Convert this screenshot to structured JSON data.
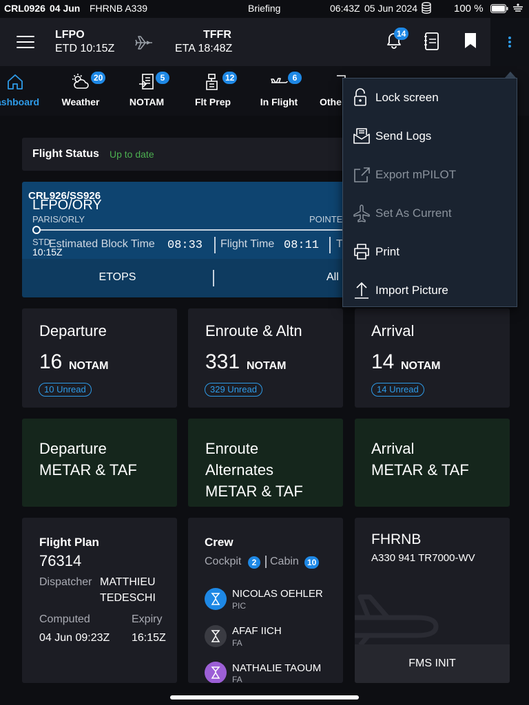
{
  "status_bar": {
    "flight_code": "CRL0926",
    "date_short": "04 Jun",
    "aircraft": "FHRNB A339",
    "app_title": "Briefing",
    "time": "06:43Z",
    "date_long": "05 Jun 2024",
    "battery": "100 %"
  },
  "header": {
    "origin": "LFPO",
    "etd": "ETD 10:15Z",
    "destination": "TFFR",
    "eta": "ETA 18:48Z",
    "notification_count": "14"
  },
  "tabs": [
    {
      "label": "ashboard",
      "icon": "home-icon",
      "badge": ""
    },
    {
      "label": "Weather",
      "icon": "weather-icon",
      "badge": "20"
    },
    {
      "label": "NOTAM",
      "icon": "notam-icon",
      "badge": "5"
    },
    {
      "label": "Flt Prep",
      "icon": "flt-prep-icon",
      "badge": "12"
    },
    {
      "label": "In Flight",
      "icon": "in-flight-icon",
      "badge": "6"
    },
    {
      "label": "Othe",
      "icon": "other-icon",
      "badge": ""
    }
  ],
  "flight_status": {
    "title": "Flight Status",
    "state": "Up to date"
  },
  "flight_banner": {
    "callsign": "CRL926/SS926",
    "airport_code": "LFPO/ORY",
    "airport_name": "PARIS/ORLY",
    "dest_name": "POINTE",
    "std_label": "STD",
    "std_time": "10:15Z",
    "ebt_label": "Estimated Block Time",
    "ebt_value": "08:33",
    "ft_label": "Flight Time",
    "ft_value": "08:11",
    "extra": "T",
    "etops": "ETOPS",
    "all": "All"
  },
  "notam_cards": [
    {
      "title": "Departure",
      "count": "16",
      "unit": "NOTAM",
      "unread": "10 Unread"
    },
    {
      "title": "Enroute & Altn",
      "count": "331",
      "unit": "NOTAM",
      "unread": "329 Unread"
    },
    {
      "title": "Arrival",
      "count": "14",
      "unit": "NOTAM",
      "unread": "14 Unread"
    }
  ],
  "metar_cards": [
    {
      "line1": "Departure",
      "line2": "METAR & TAF",
      "line3": ""
    },
    {
      "line1": "Enroute",
      "line2": "Alternates",
      "line3": "METAR & TAF"
    },
    {
      "line1": "Arrival",
      "line2": "METAR & TAF",
      "line3": ""
    }
  ],
  "flight_plan": {
    "title": "Flight Plan",
    "number": "76314",
    "dispatcher_label": "Dispatcher",
    "dispatcher_first": "MATTHIEU",
    "dispatcher_last": "TEDESCHI",
    "computed_label": "Computed",
    "computed_value": "04 Jun 09:23Z",
    "expiry_label": "Expiry",
    "expiry_value": "16:15Z"
  },
  "crew": {
    "title": "Crew",
    "cockpit_label": "Cockpit",
    "cockpit_count": "2",
    "cabin_label": "Cabin",
    "cabin_count": "10",
    "members": [
      {
        "name": "NICOLAS OEHLER",
        "role": "PIC",
        "color": "#1e88e5"
      },
      {
        "name": "AFAF IICH",
        "role": "FA",
        "color": "#3a3b42"
      },
      {
        "name": "NATHALIE TAOUM",
        "role": "FA",
        "color": "#9c5fd6"
      }
    ]
  },
  "aircraft_card": {
    "registration": "FHRNB",
    "type": "A330 941 TR7000-WV",
    "fms_button": "FMS INIT"
  },
  "menu": {
    "items": [
      {
        "label": "Lock screen",
        "icon": "lock-icon",
        "disabled": false
      },
      {
        "label": "Send Logs",
        "icon": "send-logs-icon",
        "disabled": false
      },
      {
        "label": "Export mPILOT",
        "icon": "export-icon",
        "disabled": true
      },
      {
        "label": "Set As Current",
        "icon": "airplane-icon",
        "disabled": true
      },
      {
        "label": "Print",
        "icon": "print-icon",
        "disabled": false
      },
      {
        "label": "Import Picture",
        "icon": "upload-icon",
        "disabled": false
      }
    ]
  },
  "colors": {
    "accent": "#1e88e5",
    "success": "#4caf50",
    "banner": "#0e4470",
    "menu_bg": "#1a2330"
  }
}
